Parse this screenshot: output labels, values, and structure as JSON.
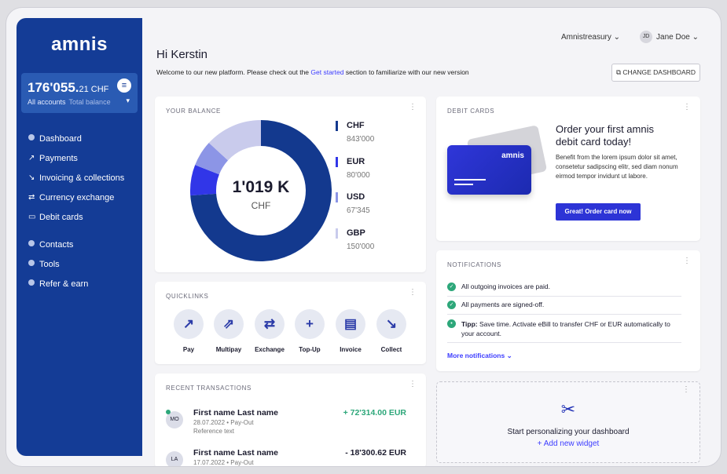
{
  "sidebar": {
    "logo": "amnis",
    "balance_main": "176'055.",
    "balance_cents": "21 CHF",
    "balance_label": "All accounts",
    "balance_sublabel": "Total balance",
    "items": [
      {
        "icon": "dot",
        "label": "Dashboard"
      },
      {
        "icon": "arrow-up-right",
        "label": "Payments"
      },
      {
        "icon": "arrow-down-right",
        "label": "Invoicing & collections"
      },
      {
        "icon": "exchange",
        "label": "Currency exchange"
      },
      {
        "icon": "card",
        "label": "Debit cards"
      },
      {
        "icon": "dot",
        "label": "Contacts"
      },
      {
        "icon": "dot",
        "label": "Tools"
      },
      {
        "icon": "dot",
        "label": "Refer & earn"
      }
    ]
  },
  "topbar": {
    "account": "Amnistreasury",
    "avatar": "JD",
    "user": "Jane Doe"
  },
  "header": {
    "greeting": "Hi Kerstin",
    "welcome_pre": "Welcome to our new platform. Please check out the ",
    "welcome_link": "Get started",
    "welcome_post": " section to familiarize with our new version",
    "change_dashboard": "CHANGE DASHBOARD"
  },
  "balance": {
    "title": "YOUR BALANCE",
    "center_value": "1'019 K",
    "center_unit": "CHF",
    "legend": [
      {
        "name": "CHF",
        "value": "843'000",
        "color": "#13398e"
      },
      {
        "name": "EUR",
        "value": "80'000",
        "color": "#3136e8"
      },
      {
        "name": "USD",
        "value": "67'345",
        "color": "#8c95e6"
      },
      {
        "name": "GBP",
        "value": "150'000",
        "color": "#c9cbec"
      }
    ]
  },
  "chart_data": {
    "type": "pie",
    "categories": [
      "CHF",
      "EUR",
      "USD",
      "GBP"
    ],
    "values": [
      843000,
      80000,
      67345,
      150000
    ],
    "colors": [
      "#13398e",
      "#3136e8",
      "#8c95e6",
      "#c9cbec"
    ]
  },
  "debit": {
    "title": "DEBIT CARDS",
    "heading": "Order your first amnis debit card today!",
    "body": "Benefit from the lorem ipsum dolor sit amet, consetetur sadipscing elitr, sed diam nonum eirmod tempor invidunt ut labore.",
    "button": "Great! Order card now",
    "card_logo": "amnis"
  },
  "quicklinks": {
    "title": "QUICKLINKS",
    "items": [
      {
        "label": "Pay",
        "glyph": "↗"
      },
      {
        "label": "Multipay",
        "glyph": "⇗"
      },
      {
        "label": "Exchange",
        "glyph": "⇄"
      },
      {
        "label": "Top-Up",
        "glyph": "+"
      },
      {
        "label": "Invoice",
        "glyph": "▤"
      },
      {
        "label": "Collect",
        "glyph": "↘"
      }
    ]
  },
  "notifications": {
    "title": "NOTIFICATIONS",
    "items": [
      "All outgoing invoices are paid.",
      "All payments are signed-off."
    ],
    "tip_label": "Tipp:",
    "tip_text": " Save time. Activate eBill to transfer CHF or EUR automatically to your account.",
    "more": "More notifications"
  },
  "transactions": {
    "title": "RECENT TRANSACTIONS",
    "rows": [
      {
        "initials": "MO",
        "name": "First name Last name",
        "date": "28.07.2022 • Pay-Out",
        "ref": "Reference text",
        "amount": "+ 72'314.00  EUR",
        "positive": true
      },
      {
        "initials": "LA",
        "name": "First name Last name",
        "date": "17.07.2022 • Pay-Out",
        "ref": "",
        "amount": "- 18'300.62  EUR",
        "positive": false
      }
    ]
  },
  "personalize": {
    "text": "Start personalizing your dashboard",
    "add": "+ Add new widget"
  }
}
